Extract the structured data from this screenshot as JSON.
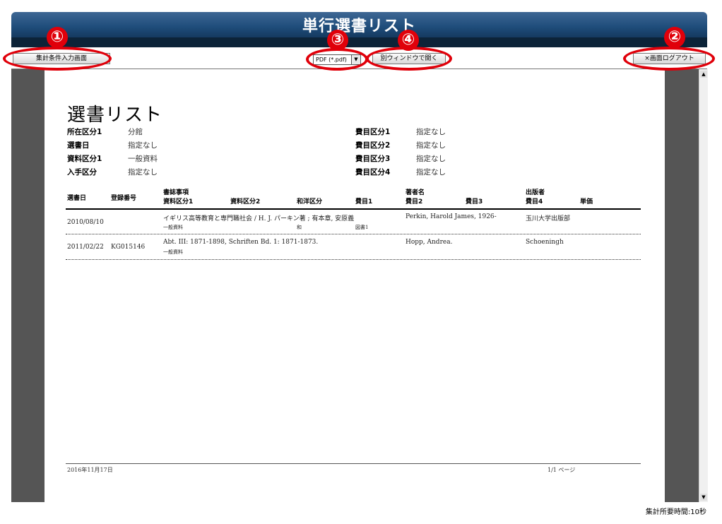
{
  "window": {
    "title": "単行選書リスト"
  },
  "toolbar": {
    "input_screen_button": "集計条件入力画面",
    "format_select": {
      "value": "PDF (*.pdf)"
    },
    "open_window_button": "別ウィンドウで開く",
    "logout_button": "×画面ログアウト"
  },
  "callouts": [
    "①",
    "②",
    "③",
    "④"
  ],
  "report": {
    "title": "選書リスト",
    "criteria_left": [
      {
        "label": "所在区分1",
        "value": "分館"
      },
      {
        "label": "選書日",
        "value": "指定なし"
      },
      {
        "label": "資料区分1",
        "value": "一般資料"
      },
      {
        "label": "入手区分",
        "value": "指定なし"
      }
    ],
    "criteria_right": [
      {
        "label": "費目区分1",
        "value": "指定なし"
      },
      {
        "label": "費目区分2",
        "value": "指定なし"
      },
      {
        "label": "費目区分3",
        "value": "指定なし"
      },
      {
        "label": "費目区分4",
        "value": "指定なし"
      }
    ],
    "headers": {
      "date": "選書日",
      "reg_no": "登録番号",
      "biblio": "書誌事項",
      "type1": "資料区分1",
      "type2": "資料区分2",
      "lang": "和洋区分",
      "budget1": "費目1",
      "author": "著者名",
      "budget2": "費目2",
      "budget3": "費目3",
      "publisher": "出版者",
      "budget4": "費目4",
      "price": "単価"
    },
    "rows": [
      {
        "date": "2010/08/10",
        "reg_no": "",
        "biblio": "イギリス高等教育と専門職社会 / H. J. パーキン著 ; 有本章, 安原義",
        "type1": "一般資料",
        "lang": "和",
        "budget1": "図書1",
        "author": "Perkin, Harold James, 1926-",
        "publisher": "玉川大学出版部"
      },
      {
        "date": "2011/02/22",
        "reg_no": "KG015146",
        "biblio": "Abt. III: 1871-1898, Schriften Bd. 1: 1871-1873.",
        "type1": "一般資料",
        "lang": "",
        "budget1": "",
        "author": "Hopp, Andrea.",
        "publisher": "Schoeningh"
      }
    ],
    "footer": {
      "date": "2016年11月17日",
      "page": "1/1 ページ"
    }
  },
  "status": {
    "elapsed": "集計所要時間:10秒"
  }
}
